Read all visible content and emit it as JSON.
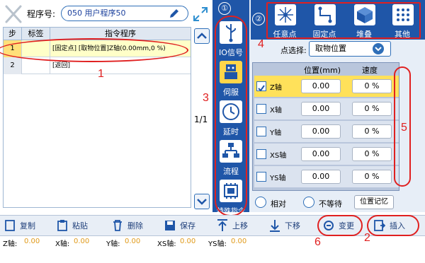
{
  "header": {
    "program_label": "程序号:",
    "program_value": "050 用户程序50"
  },
  "table": {
    "headers": [
      "步",
      "标签",
      "指令程序"
    ],
    "rows": [
      {
        "step": "1",
        "tag": "",
        "instruction": "[固定点] [取物位置]Z轴(0.00mm,0 %)"
      },
      {
        "step": "2",
        "tag": "",
        "instruction": "[返回]"
      }
    ]
  },
  "page_indicator": "1/1",
  "categories": {
    "circle_number": "①",
    "items": [
      {
        "label": "IO信号",
        "icon": "usb-icon"
      },
      {
        "label": "伺服",
        "icon": "servo-robot-icon"
      },
      {
        "label": "延时",
        "icon": "clock-icon"
      },
      {
        "label": "流程",
        "icon": "flow-icon"
      },
      {
        "label": "特殊指令",
        "icon": "special-chip-icon"
      }
    ]
  },
  "point_types": {
    "circle_number": "②",
    "items": [
      {
        "label": "任意点",
        "icon": "any-point-icon"
      },
      {
        "label": "固定点",
        "icon": "fixed-point-icon"
      },
      {
        "label": "堆叠",
        "icon": "stack-cube-icon"
      },
      {
        "label": "其他",
        "icon": "other-grid-icon"
      }
    ]
  },
  "point_select": {
    "label": "点选择:",
    "value": "取物位置"
  },
  "axes_table": {
    "headers": [
      "位置(mm)",
      "速度"
    ],
    "rows": [
      {
        "axis": "Z轴",
        "position": "0.00",
        "speed": "0 %",
        "checked": true
      },
      {
        "axis": "X轴",
        "position": "0.00",
        "speed": "0 %",
        "checked": false
      },
      {
        "axis": "Y轴",
        "position": "0.00",
        "speed": "0 %",
        "checked": false
      },
      {
        "axis": "XS轴",
        "position": "0.00",
        "speed": "0 %",
        "checked": false
      },
      {
        "axis": "YS轴",
        "position": "0.00",
        "speed": "0 %",
        "checked": false
      }
    ]
  },
  "options": {
    "relative_label": "相对",
    "no_wait_label": "不等待",
    "pos_memory_label": "位置记忆"
  },
  "toolbar": {
    "copy": "复制",
    "paste": "粘贴",
    "delete": "删除",
    "save": "保存",
    "up": "上移",
    "down": "下移",
    "change": "变更",
    "insert": "插入"
  },
  "status": {
    "z_label": "Z轴:",
    "z": "0.00",
    "x_label": "X轴:",
    "x": "0.00",
    "y_label": "Y轴:",
    "y": "0.00",
    "xs_label": "XS轴:",
    "xs": "0.00",
    "ys_label": "YS轴:",
    "ys": "0.00"
  },
  "annotations": [
    "1",
    "2",
    "3",
    "4",
    "5",
    "6"
  ],
  "colors": {
    "primary": "#1f56a8",
    "highlight_row": "#ffffc8",
    "selected_axis": "#ffe15a",
    "annotation": "#e02020",
    "status_value": "#e09a1a"
  }
}
